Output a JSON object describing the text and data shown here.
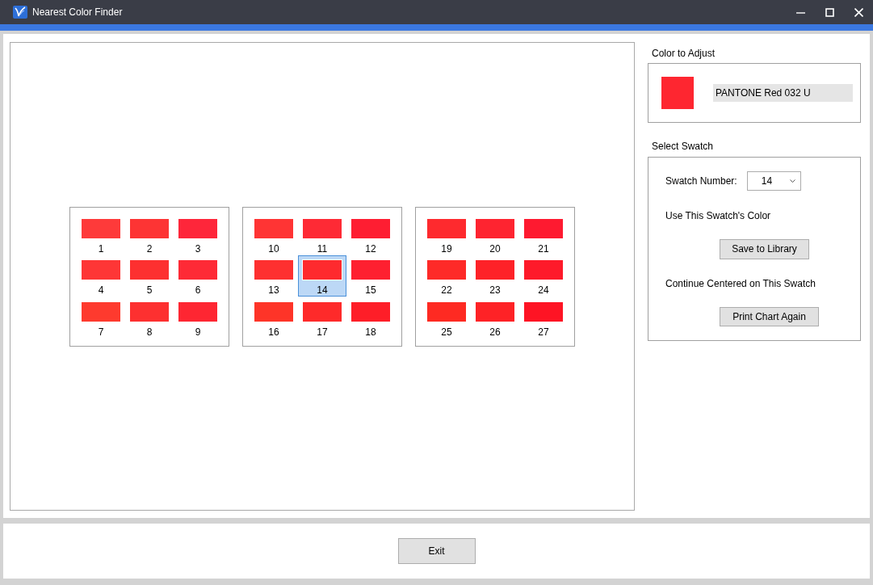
{
  "window": {
    "title": "Nearest Color Finder"
  },
  "chart": {
    "groups": [
      {
        "swatches": [
          {
            "label": "1",
            "color": "#fe3a3a",
            "selected": false
          },
          {
            "label": "2",
            "color": "#fd3434",
            "selected": false
          },
          {
            "label": "3",
            "color": "#fe263a",
            "selected": false
          },
          {
            "label": "4",
            "color": "#fe3636",
            "selected": false
          },
          {
            "label": "5",
            "color": "#fd3030",
            "selected": false
          },
          {
            "label": "6",
            "color": "#fe2a36",
            "selected": false
          },
          {
            "label": "7",
            "color": "#fe3a2e",
            "selected": false
          },
          {
            "label": "8",
            "color": "#fd3030",
            "selected": false
          },
          {
            "label": "9",
            "color": "#fe2632",
            "selected": false
          }
        ]
      },
      {
        "swatches": [
          {
            "label": "10",
            "color": "#ff3434",
            "selected": false
          },
          {
            "label": "11",
            "color": "#fe2a35",
            "selected": false
          },
          {
            "label": "12",
            "color": "#fe1e32",
            "selected": false
          },
          {
            "label": "13",
            "color": "#fe3030",
            "selected": false
          },
          {
            "label": "14",
            "color": "#fe2a2e",
            "selected": true
          },
          {
            "label": "15",
            "color": "#fe2030",
            "selected": false
          },
          {
            "label": "16",
            "color": "#fe3428",
            "selected": false
          },
          {
            "label": "17",
            "color": "#fe2a2a",
            "selected": false
          },
          {
            "label": "18",
            "color": "#fe1e28",
            "selected": false
          }
        ]
      },
      {
        "swatches": [
          {
            "label": "19",
            "color": "#fe2a2e",
            "selected": false
          },
          {
            "label": "20",
            "color": "#fe2430",
            "selected": false
          },
          {
            "label": "21",
            "color": "#fe1a30",
            "selected": false
          },
          {
            "label": "22",
            "color": "#fe2a28",
            "selected": false
          },
          {
            "label": "23",
            "color": "#fe2228",
            "selected": false
          },
          {
            "label": "24",
            "color": "#fe1a2a",
            "selected": false
          },
          {
            "label": "25",
            "color": "#fe2a22",
            "selected": false
          },
          {
            "label": "26",
            "color": "#fe2226",
            "selected": false
          },
          {
            "label": "27",
            "color": "#fe1424",
            "selected": false
          }
        ]
      }
    ]
  },
  "color_to_adjust": {
    "heading": "Color to Adjust",
    "color": "#fe2630",
    "name": "PANTONE Red 032 U"
  },
  "select_swatch": {
    "heading": "Select Swatch",
    "swatch_number_label": "Swatch Number:",
    "swatch_number": "14",
    "use_color_label": "Use This Swatch's Color",
    "save_button": "Save to Library",
    "continue_label": "Continue Centered on This Swatch",
    "print_button": "Print Chart Again"
  },
  "footer": {
    "exit_button": "Exit"
  }
}
